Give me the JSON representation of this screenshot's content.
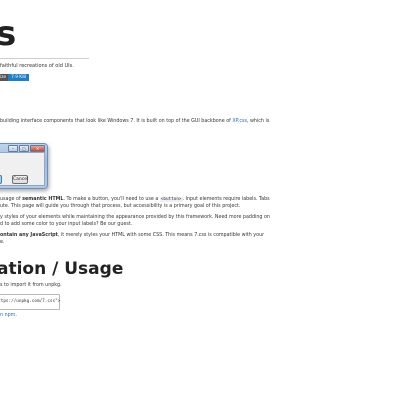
{
  "hero": {
    "title": "s",
    "tagline": "faithful recreations of old UIs.",
    "badge_label": "ize",
    "badge_value": "7.9 KiB"
  },
  "intro": {
    "text_before_link": "building interface components that look like Windows 7. It is built on top of the GUI backbone of ",
    "link": "XP.css",
    "text_after_link": ", which is"
  },
  "window_preview": {
    "min_glyph": "–",
    "max_glyph": "□",
    "close_glyph": "✕",
    "ok_label": "",
    "cancel_label": "Cancel"
  },
  "para_semantic": {
    "line1_a": "usage of ",
    "line1_bold": "semantic HTML",
    "line1_b": ". To make a button, you'll need to use a ",
    "line1_code": "<button>",
    "line1_c": ". Input elements require labels. Tabs",
    "line2": "ute. This page will guide you through that process, but accessibility is a primary goal of this project."
  },
  "para_styles": {
    "line1": "y styles of your elements while maintaining the appearance provided by this framework. Need more padding on",
    "line2": "d to add some color to your input labels? Be our guest."
  },
  "para_js": {
    "line1_bold": "ontain any JavaScript",
    "line1_rest": ", it merely styles your HTML with some CSS. This means 7.css is compatible with your",
    "line2": "e."
  },
  "installation": {
    "heading": "ation / Usage",
    "subtext": "s to import it from unpkg.",
    "snippet": "\"https://unpkg.com/7.css\">",
    "npm_link": "n npm",
    "npm_after": "."
  }
}
